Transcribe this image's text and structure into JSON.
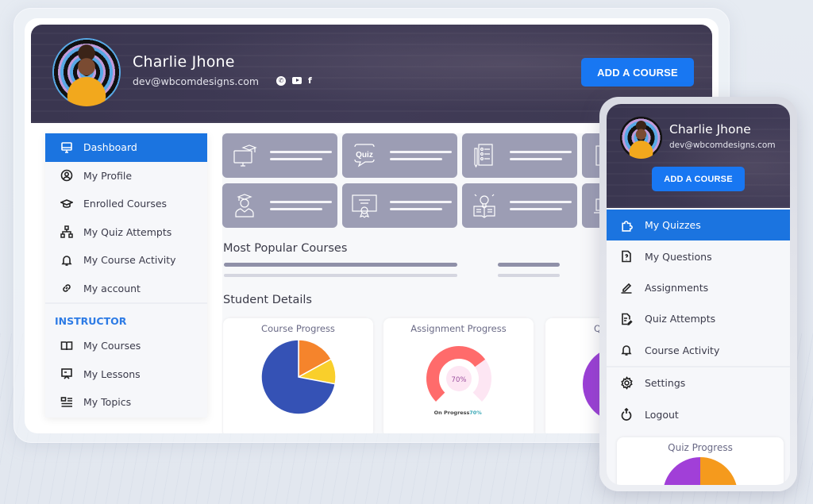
{
  "profile": {
    "name": "Charlie Jhone",
    "email": "dev@wbcomdesigns.com",
    "social_icons": [
      "whatsapp-icon",
      "youtube-icon",
      "facebook-icon"
    ],
    "add_course_label": "ADD A COURSE"
  },
  "sidebar": {
    "items": [
      {
        "label": "Dashboard",
        "icon": "monitor-icon",
        "active": true
      },
      {
        "label": "My Profile",
        "icon": "user-circle-icon",
        "active": false
      },
      {
        "label": "Enrolled Courses",
        "icon": "graduation-cap-icon",
        "active": false
      },
      {
        "label": "My Quiz Attempts",
        "icon": "sitemap-icon",
        "active": false
      },
      {
        "label": "My Course Activity",
        "icon": "bell-icon",
        "active": false
      },
      {
        "label": "My account",
        "icon": "link-icon",
        "active": false
      }
    ],
    "instructor_title": "INSTRUCTOR",
    "instructor_items": [
      {
        "label": "My Courses",
        "icon": "book-open-icon"
      },
      {
        "label": "My Lessons",
        "icon": "presentation-icon"
      },
      {
        "label": "My Topics",
        "icon": "topics-list-icon"
      }
    ]
  },
  "stat_tiles": [
    {
      "icon": "computer-graduation-icon"
    },
    {
      "icon": "quiz-bubble-icon",
      "icon_text": "Quiz"
    },
    {
      "icon": "checklist-icon"
    },
    {
      "icon": "book-icon"
    },
    {
      "icon": "student-icon"
    },
    {
      "icon": "certificate-icon"
    },
    {
      "icon": "lightbulb-book-icon"
    },
    {
      "icon": "laptop-icon"
    }
  ],
  "sections": {
    "popular_courses": "Most Popular Courses",
    "student_details": "Student Details"
  },
  "cards": {
    "course_progress": {
      "title": "Course Progress",
      "slices": [
        {
          "label": "blue",
          "value": 72,
          "color": "#3552b5"
        },
        {
          "label": "orange",
          "value": 17,
          "color": "#f5842c"
        },
        {
          "label": "yellow",
          "value": 11,
          "color": "#f9cf2b"
        }
      ]
    },
    "assignment_progress": {
      "title": "Assignment Progress",
      "center_label": "70%",
      "legend_label": "On Progress",
      "legend_value": "70%",
      "percent": 70,
      "color_fill": "#ff6b6b",
      "color_track": "#fde6f3"
    },
    "third_card_title_partial": "Q",
    "third_card_color": "#9b3fd6"
  },
  "mobile": {
    "items": [
      {
        "label": "My Quizzes",
        "icon": "puzzle-icon",
        "active": true
      },
      {
        "label": "My Questions",
        "icon": "question-file-icon",
        "active": false
      },
      {
        "label": "Assignments",
        "icon": "pencil-icon",
        "active": false
      },
      {
        "label": "Quiz Attempts",
        "icon": "file-edit-icon",
        "active": false
      },
      {
        "label": "Course Activity",
        "icon": "bell-icon",
        "active": false
      }
    ],
    "bottom_items": [
      {
        "label": "Settings",
        "icon": "gear-icon"
      },
      {
        "label": "Logout",
        "icon": "logout-icon"
      }
    ],
    "quiz_progress_title": "Quiz Progress",
    "quiz_colors": [
      "#a13fd8",
      "#f59a1d"
    ]
  }
}
